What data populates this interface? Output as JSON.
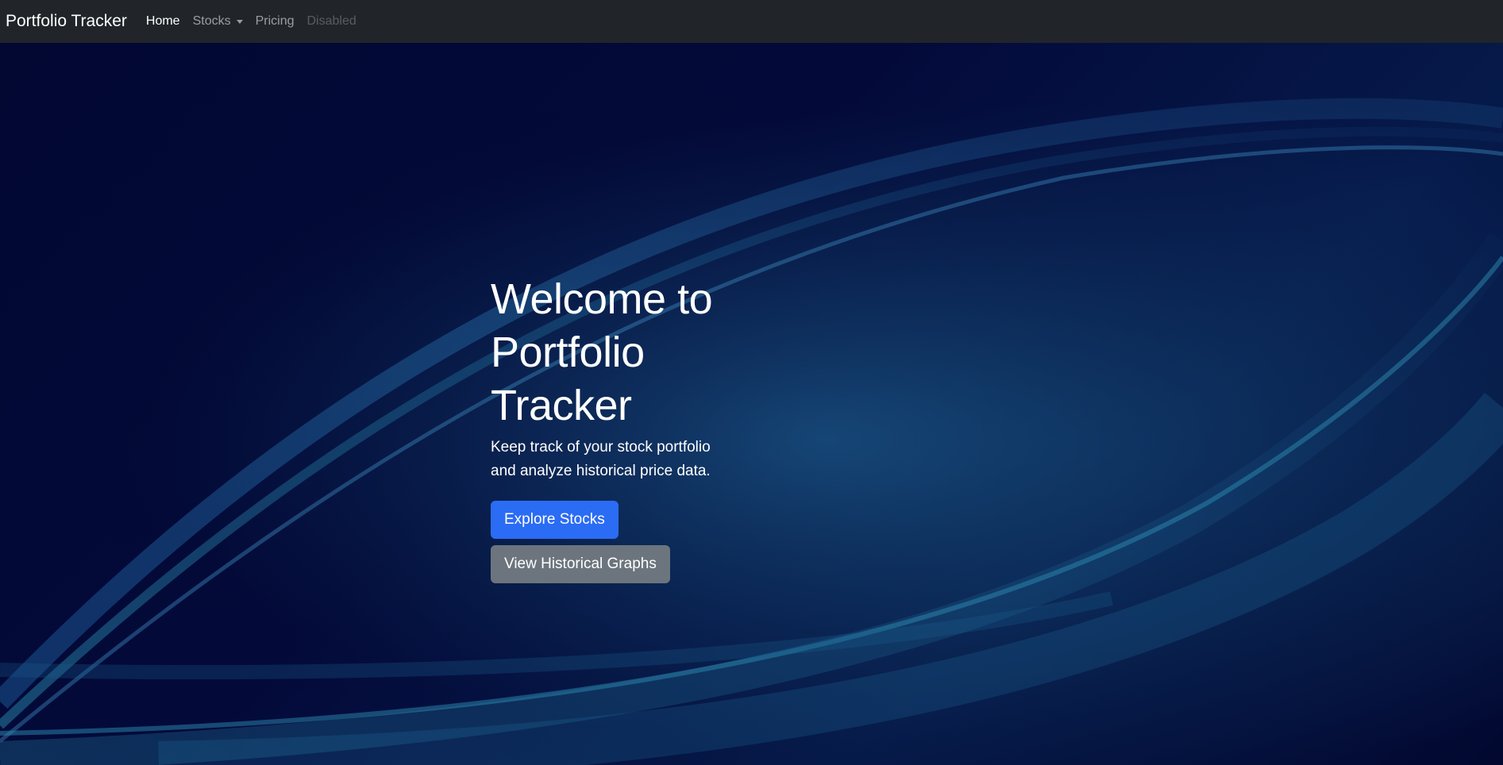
{
  "navbar": {
    "brand": "Portfolio Tracker",
    "links": [
      {
        "label": "Home",
        "state": "active"
      },
      {
        "label": "Stocks",
        "state": "dropdown"
      },
      {
        "label": "Pricing",
        "state": "normal"
      },
      {
        "label": "Disabled",
        "state": "disabled"
      }
    ]
  },
  "hero": {
    "title_line1": "Welcome to",
    "title_line2": "Portfolio",
    "title_line3": "Tracker",
    "subtitle_line1": "Keep track of your stock portfolio",
    "subtitle_line2": "and analyze historical price data.",
    "primary_button": "Explore Stocks",
    "secondary_button": "View Historical Graphs"
  },
  "colors": {
    "navbar_bg": "#212529",
    "primary": "#2b6cf5",
    "secondary": "#6c757d",
    "hero_bg": "#020828"
  }
}
